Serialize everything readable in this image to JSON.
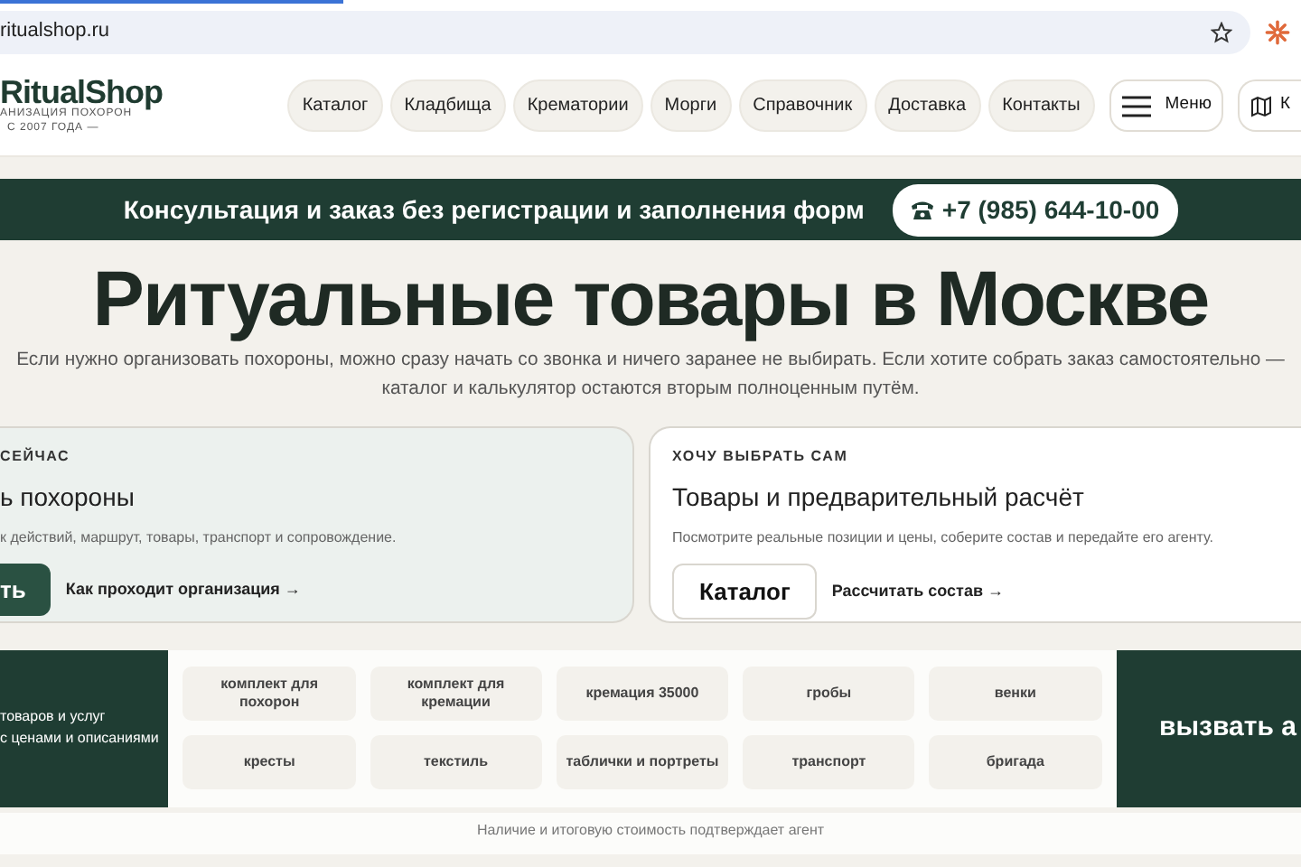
{
  "browser": {
    "url": "ritualshop.ru"
  },
  "header": {
    "logo": {
      "name": "RitualShop",
      "tagline_1": "АНИЗАЦИЯ ПОХОРОН",
      "tagline_2": "С 2007 ГОДА —"
    },
    "nav": [
      "Каталог",
      "Кладбища",
      "Крематории",
      "Морги",
      "Справочник",
      "Доставка",
      "Контакты"
    ],
    "menu_button": "Меню",
    "map_button": "К"
  },
  "banner": {
    "text": "Консультация и заказ без регистрации и заполнения форм",
    "phone": "+7 (985) 644-10-00"
  },
  "hero": {
    "title": "Ритуальные товары в Москве",
    "subtitle": "Если нужно организовать похороны, можно сразу начать со звонка и ничего заранее не выбирать. Если хотите собрать заказ самостоятельно — каталог и калькулятор остаются вторым полноценным путём."
  },
  "cards": [
    {
      "kind": "primary",
      "eyebrow": "СЕЙЧАС",
      "title": "ь похороны",
      "description": "к действий, маршрут, товары, транспорт и сопровождение.",
      "button": "ть",
      "link": "Как проходит организация →"
    },
    {
      "kind": "secondary",
      "eyebrow": "ХОЧУ ВЫБРАТЬ САМ",
      "title": "Товары и предварительный расчёт",
      "description": "Посмотрите реальные позиции и цены, соберите состав и передайте его агенту.",
      "button": "Каталог",
      "link": "Рассчитать состав →"
    }
  ],
  "catalog_strip": {
    "intro_lines": [
      "товаров и услуг",
      "с ценами и описаниями"
    ],
    "chips": [
      "комплект для похорон",
      "комплект для кремации",
      "кремация 35000",
      "гробы",
      "венки",
      "кресты",
      "текстиль",
      "таблички и портреты",
      "транспорт",
      "бригада"
    ],
    "cta": "вызвать а"
  },
  "footnote": "Наличие и итоговую стоимость подтверждает агент"
}
